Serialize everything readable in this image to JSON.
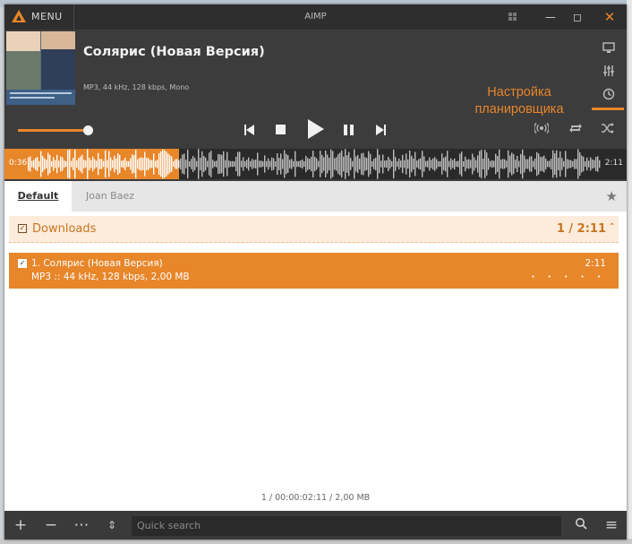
{
  "window": {
    "title": "AIMP",
    "menu_label": "MENU"
  },
  "track": {
    "title": "Солярис (Новая Версия)",
    "meta": "MP3, 44 kHz, 128 kbps, Mono",
    "time_elapsed": "0:36",
    "time_total": "2:11",
    "progress": 0.28,
    "volume": 0.92
  },
  "tooltip": {
    "text_line1": "Настройка",
    "text_line2": "планировщика"
  },
  "tabs": [
    {
      "label": "Default",
      "active": true
    },
    {
      "label": "Joan Baez",
      "active": false
    }
  ],
  "playlist": {
    "group": {
      "name": "Downloads",
      "count": "1 / 2:11"
    },
    "items": [
      {
        "title": "1. Солярис (Новая Версия)",
        "meta": "MP3 :: 44 kHz, 128 kbps, 2,00 MB",
        "duration": "2:11",
        "rating": "• • • • •"
      }
    ],
    "summary": "1 / 00:00:02:11 / 2,00 MB"
  },
  "search": {
    "placeholder": "Quick search"
  },
  "icons": {
    "logo": "aimp-logo-icon",
    "grid": "grid-icon",
    "minimize": "minimize-icon",
    "maximize": "maximize-icon",
    "close": "close-icon",
    "display": "monitor-icon",
    "equalizer": "equalizer-icon",
    "scheduler": "clock-icon"
  },
  "colors": {
    "accent": "#e8862a",
    "background": "#3c3c3c",
    "playlist_bg": "#ffffff"
  }
}
